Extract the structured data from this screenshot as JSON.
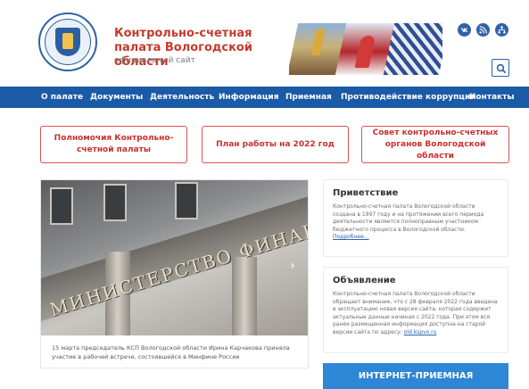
{
  "header": {
    "title": "Контрольно-счетная палата Вологодской области",
    "subtitle": "официальный сайт"
  },
  "social": [
    {
      "icon": "vk-icon"
    },
    {
      "icon": "rss-icon"
    },
    {
      "icon": "sitemap-icon"
    }
  ],
  "search": {
    "icon": "search-icon"
  },
  "nav": {
    "items": [
      "О палате",
      "Документы",
      "Деятельность",
      "Информация",
      "Приемная",
      "Противодействие коррупции",
      "Контакты"
    ]
  },
  "quick_links": [
    "Полномочия Контрольно-счетной палаты",
    "План работы на 2022 год",
    "Совет контрольно-счетных органов Вологодской области"
  ],
  "slider": {
    "sign_text": "МИНИСТЕРСТВО ФИНАНСОВ Р",
    "next_arrow": "›",
    "caption": "15 марта председатель КСП Вологодской области Ирина Карчакова приняла участие в рабочей встрече, состоявшейся в Минфине России"
  },
  "greeting": {
    "title": "Приветствие",
    "text": "Контрольно-счетная палата Вологодской области создана в 1997 году и на протяжении всего периода деятельности является полноправным участником бюджетного процесса в Вологодской области.",
    "more": "Подробнее..."
  },
  "announcement": {
    "title": "Объявление",
    "text": "Контрольно-счетная палата Вологодской области обращает внимание, что с 28 февраля 2022 года введена в эксплуатацию новая версия сайта, которая содержит актуальные данные начиная с 2022 года. При этом вся ранее размещенная информация доступна на старой версии сайта по адресу:",
    "link": "old.kspvo.ru"
  },
  "cta": {
    "label": "ИНТЕРНЕТ-ПРИЕМНАЯ"
  },
  "colors": {
    "accent_red": "#c33b2b",
    "nav_blue": "#1b5aa6",
    "cta_blue": "#2e86d6"
  }
}
